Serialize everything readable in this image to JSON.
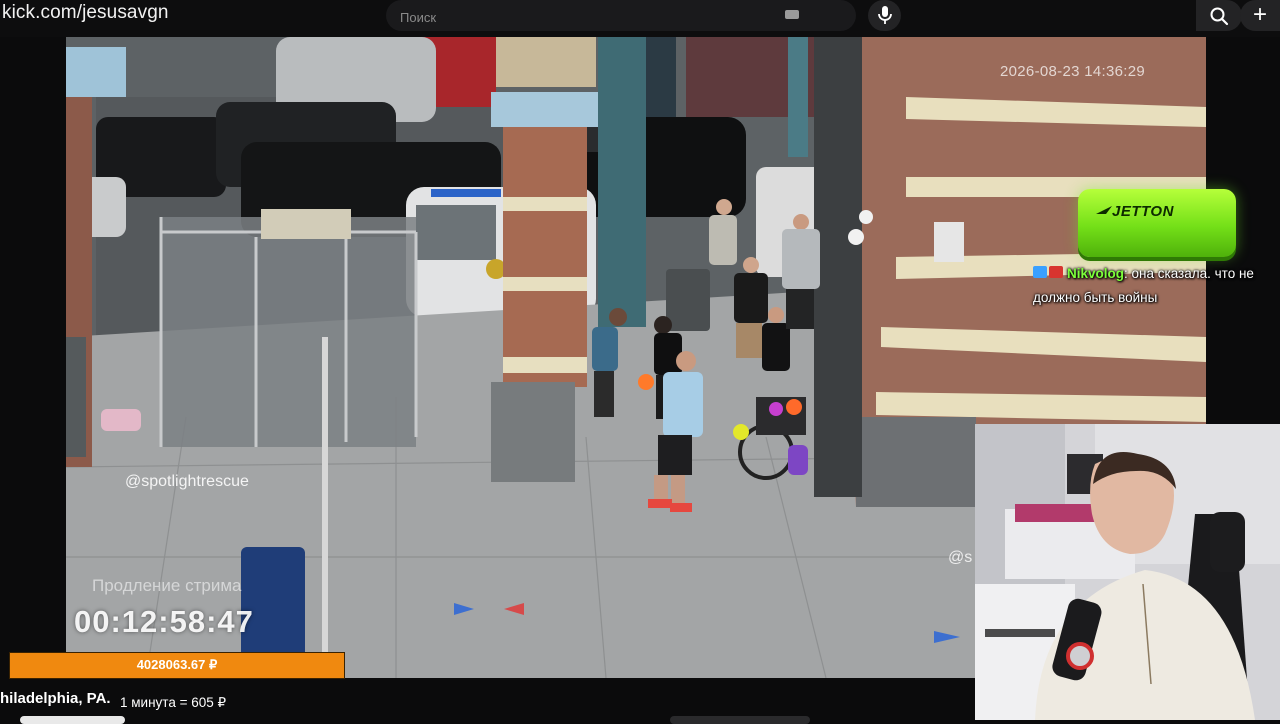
{
  "browser": {
    "url": "kick.com/jesusavgn"
  },
  "search": {
    "placeholder": "Поиск"
  },
  "video": {
    "camera_timestamp": "2026-08-23 14:36:29",
    "watermark": "@spotlightrescue",
    "watermark_partial": "@s"
  },
  "sponsor": {
    "logo_text": "JETTON"
  },
  "chat": {
    "username": "Nikvolog",
    "message": ": она сказала. что не должно быть войны"
  },
  "stream_extension": {
    "label": "Продление стрима",
    "timer": "00:12:58:47"
  },
  "donation": {
    "amount": "4028063.67 ₽"
  },
  "footer": {
    "location": "hiladelphia, PA.",
    "rate": "1 минута = 605 ₽"
  },
  "icons": [
    "search-icon",
    "microphone-icon",
    "plus-icon",
    "keyboard-icon"
  ],
  "colors": {
    "accent_green": "#7dff3b",
    "donation_orange": "#f0890f"
  }
}
